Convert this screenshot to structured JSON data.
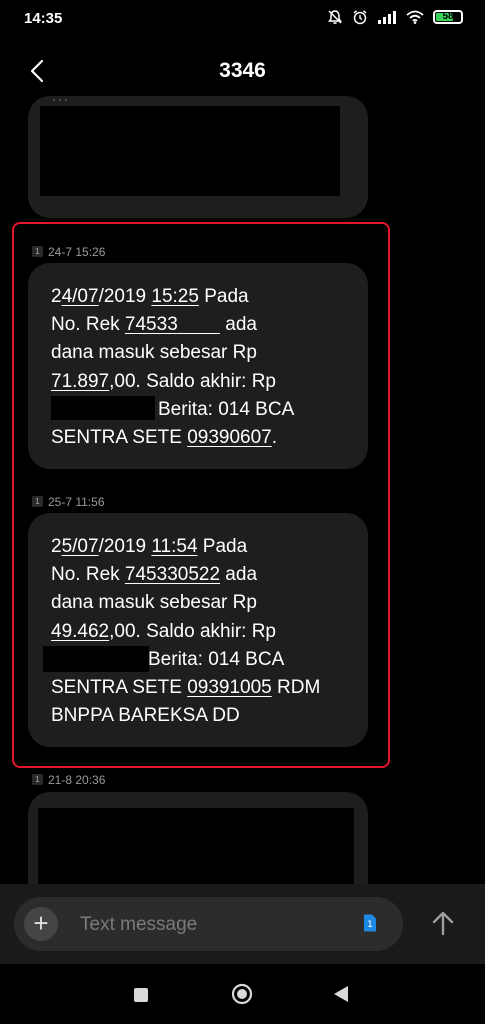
{
  "status_bar": {
    "time": "14:35",
    "battery_level": "58",
    "icons": [
      "mute-icon",
      "alarm-icon",
      "signal-icon",
      "wifi-icon",
      "battery-icon"
    ]
  },
  "header": {
    "title": "3346",
    "back_icon": "back-arrow-icon"
  },
  "top_message": {
    "partial_text": "..."
  },
  "messages": [
    {
      "sim": "1",
      "timestamp": "24-7 15:26",
      "lines": [
        [
          {
            "t": "2",
            "u": false
          },
          {
            "t": "4/07",
            "u": true
          },
          {
            "t": "/2019 ",
            "u": false
          },
          {
            "t": "15:25",
            "u": true
          },
          {
            "t": " Pada",
            "u": false
          }
        ],
        [
          {
            "t": "No. Rek ",
            "u": false
          },
          {
            "t": "74533",
            "u": true
          },
          {
            "t": "        ",
            "u": true
          },
          {
            "t": " ada",
            "u": false
          }
        ],
        [
          {
            "t": "dana masuk sebesar Rp",
            "u": false
          }
        ],
        [
          {
            "t": "71.897",
            "u": true
          },
          {
            "t": ",00. Saldo akhir: Rp",
            "u": false
          }
        ],
        [
          {
            "t": "Berita: 014 BCA",
            "u": false
          }
        ],
        [
          {
            "t": "SENTRA SETE ",
            "u": false
          },
          {
            "t": "09390607",
            "u": true
          },
          {
            "t": ".",
            "u": false
          }
        ]
      ]
    },
    {
      "sim": "1",
      "timestamp": "25-7 11:56",
      "lines": [
        [
          {
            "t": "2",
            "u": false
          },
          {
            "t": "5/07",
            "u": true
          },
          {
            "t": "/2019 ",
            "u": false
          },
          {
            "t": "11:54",
            "u": true
          },
          {
            "t": " Pada",
            "u": false
          }
        ],
        [
          {
            "t": "No. Rek ",
            "u": false
          },
          {
            "t": "745330522",
            "u": true
          },
          {
            "t": " ada",
            "u": false
          }
        ],
        [
          {
            "t": "dana masuk sebesar Rp",
            "u": false
          }
        ],
        [
          {
            "t": "49.462",
            "u": true
          },
          {
            "t": ",00. Saldo akhir: Rp",
            "u": false
          }
        ],
        [
          {
            "t": "Berita: 014 BCA",
            "u": false
          }
        ],
        [
          {
            "t": "SENTRA SETE ",
            "u": false
          },
          {
            "t": "09391005",
            "u": true
          },
          {
            "t": " RDM",
            "u": false
          }
        ],
        [
          {
            "t": "BNPPA BAREKSA DD",
            "u": false
          }
        ]
      ]
    },
    {
      "sim": "1",
      "timestamp": "21-8 20:36",
      "lines": []
    }
  ],
  "compose": {
    "placeholder": "Text message",
    "sim_label": "1",
    "plus_label": "+"
  },
  "colors": {
    "background": "#000000",
    "bubble": "#1e1e1e",
    "highlight": "#e5152b",
    "battery": "#3ad35a",
    "sim_icon": "#1e88e5"
  }
}
